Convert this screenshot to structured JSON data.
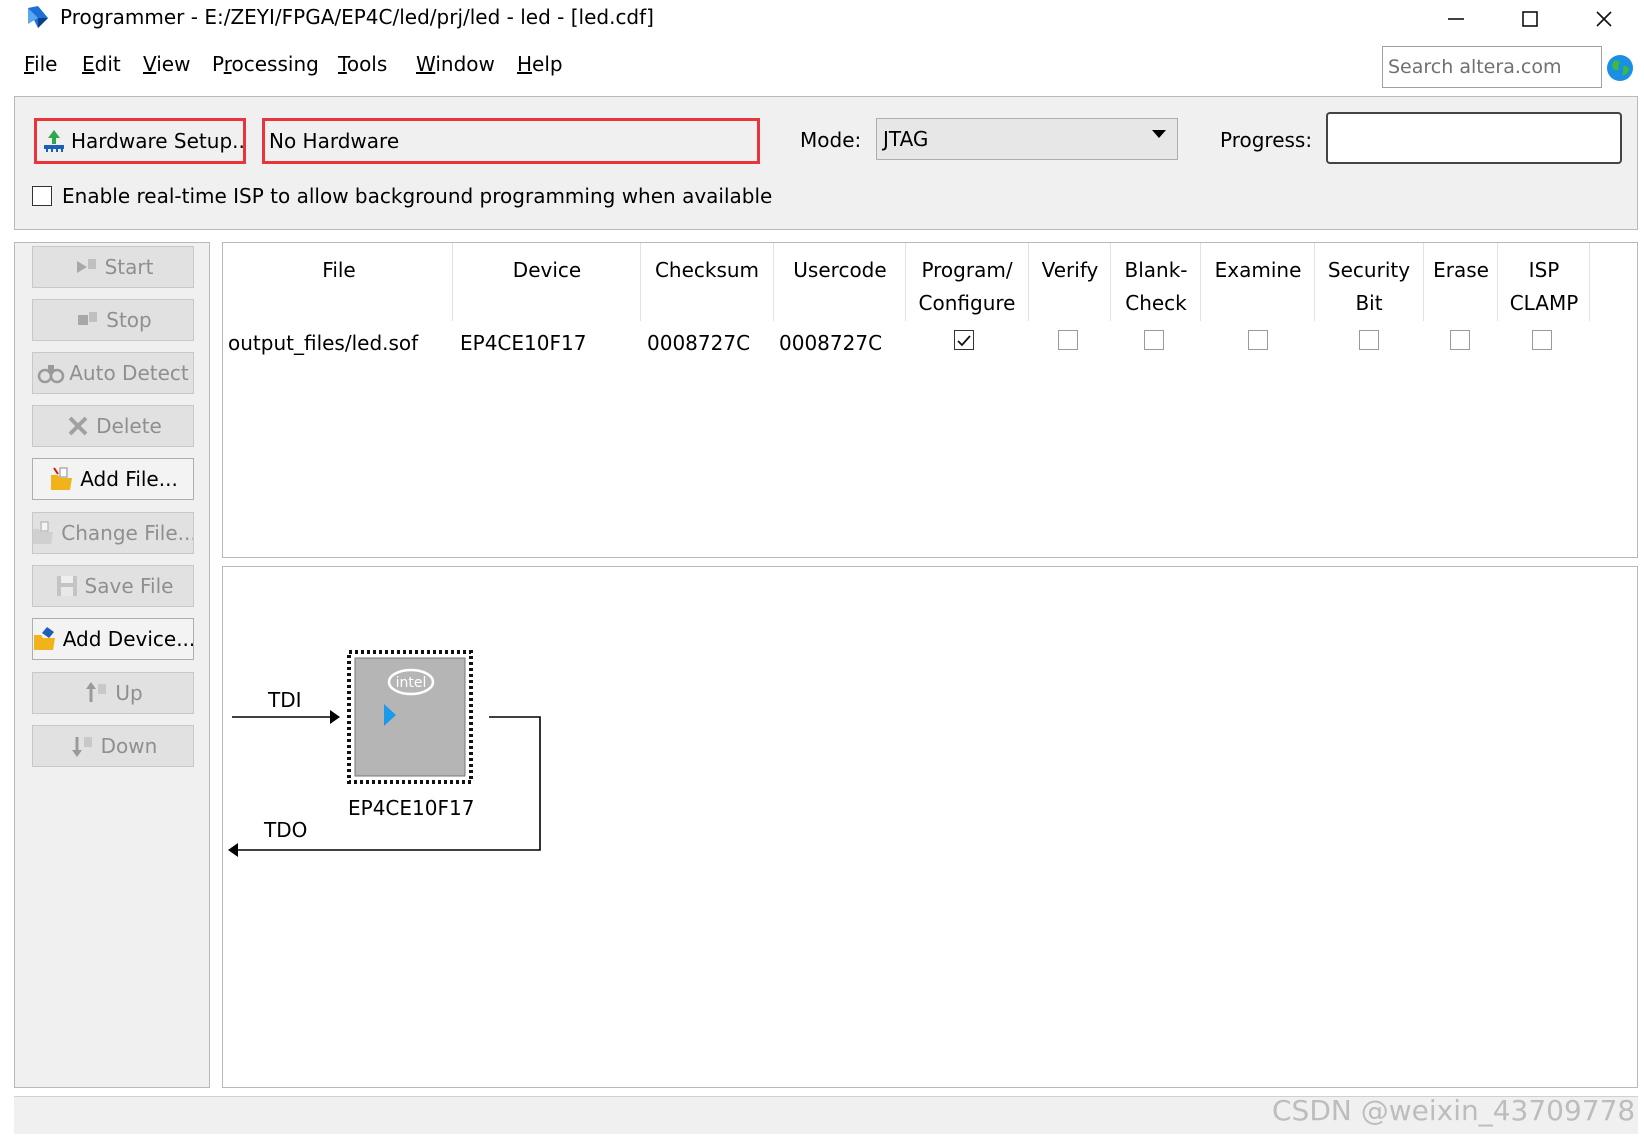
{
  "window": {
    "title": "Programmer - E:/ZEYI/FPGA/EP4C/led/prj/led - led - [led.cdf]",
    "controls": {
      "minimize": "—",
      "maximize": "☐",
      "close": "✕"
    }
  },
  "menu": {
    "items": [
      {
        "label": "File",
        "accel": "F",
        "rest": "ile"
      },
      {
        "label": "Edit",
        "accel": "E",
        "rest": "dit"
      },
      {
        "label": "View",
        "accel": "V",
        "rest": "iew"
      },
      {
        "label": "Processing",
        "accel": "r",
        "pre": "P",
        "rest": "ocessing"
      },
      {
        "label": "Tools",
        "accel": "T",
        "rest": "ools"
      },
      {
        "label": "Window",
        "accel": "W",
        "rest": "indow"
      },
      {
        "label": "Help",
        "accel": "H",
        "rest": "elp"
      }
    ]
  },
  "search": {
    "placeholder": "Search altera.com",
    "icon": "globe-icon"
  },
  "hardware": {
    "setup_label": "Hardware Setup...",
    "current": "No Hardware",
    "highlight_color": "#e8343a"
  },
  "mode": {
    "label": "Mode:",
    "value": "JTAG"
  },
  "progress": {
    "label": "Progress:",
    "value": 0
  },
  "isp": {
    "label": "Enable real-time ISP to allow background programming when available",
    "checked": false
  },
  "side_buttons": [
    {
      "label": "Start",
      "enabled": false,
      "icon": "start-icon"
    },
    {
      "label": "Stop",
      "enabled": false,
      "icon": "stop-icon"
    },
    {
      "label": "Auto Detect",
      "enabled": false,
      "icon": "auto-detect-icon"
    },
    {
      "label": "Delete",
      "enabled": false,
      "icon": "delete-icon"
    },
    {
      "label": "Add File...",
      "enabled": true,
      "icon": "add-file-icon"
    },
    {
      "label": "Change File...",
      "enabled": false,
      "icon": "change-file-icon"
    },
    {
      "label": "Save File",
      "enabled": false,
      "icon": "save-file-icon"
    },
    {
      "label": "Add Device...",
      "enabled": true,
      "icon": "add-device-icon"
    },
    {
      "label": "Up",
      "enabled": false,
      "icon": "up-icon"
    },
    {
      "label": "Down",
      "enabled": false,
      "icon": "down-icon"
    }
  ],
  "table": {
    "columns": [
      {
        "line1": "File",
        "line2": ""
      },
      {
        "line1": "Device",
        "line2": ""
      },
      {
        "line1": "Checksum",
        "line2": ""
      },
      {
        "line1": "Usercode",
        "line2": ""
      },
      {
        "line1": "Program/",
        "line2": "Configure"
      },
      {
        "line1": "Verify",
        "line2": ""
      },
      {
        "line1": "Blank-",
        "line2": "Check"
      },
      {
        "line1": "Examine",
        "line2": ""
      },
      {
        "line1": "Security",
        "line2": "Bit"
      },
      {
        "line1": "Erase",
        "line2": ""
      },
      {
        "line1": "ISP",
        "line2": "CLAMP"
      }
    ],
    "rows": [
      {
        "file": "output_files/led.sof",
        "device": "EP4CE10F17",
        "checksum": "0008727C",
        "usercode": "0008727C",
        "program_configure": true,
        "verify": false,
        "blank_check": false,
        "examine": false,
        "security_bit": false,
        "erase": false,
        "isp_clamp": false
      }
    ]
  },
  "chain": {
    "tdi": "TDI",
    "tdo": "TDO",
    "chip_name": "EP4CE10F17",
    "chip_logo": "intel"
  },
  "watermark": "CSDN @weixin_43709778"
}
